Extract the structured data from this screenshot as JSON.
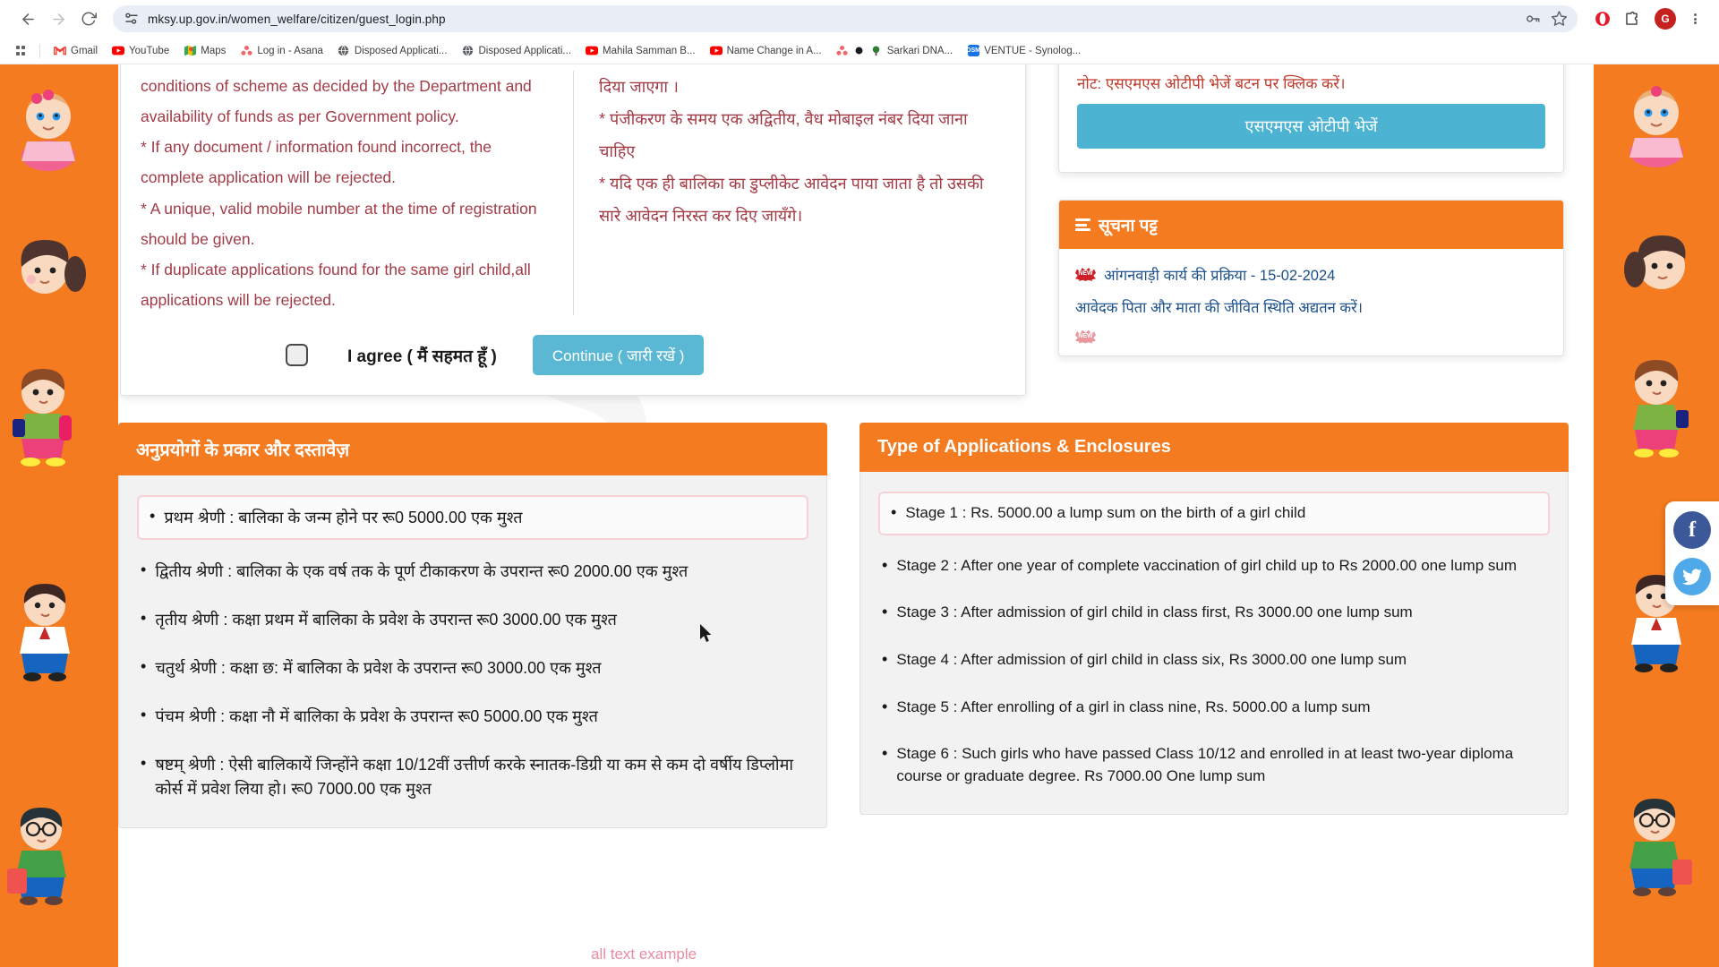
{
  "browser": {
    "url": "mksy.up.gov.in/women_welfare/citizen/guest_login.php",
    "back_icon": "back-arrow-icon",
    "forward_icon": "forward-arrow-icon",
    "reload_icon": "reload-icon",
    "site_settings_icon": "site-settings-icon",
    "password_icon": "password-key-icon",
    "bookmark_icon": "bookmark-star-icon",
    "profile_initial": "G",
    "bookmarks": [
      {
        "label": "Gmail",
        "icon": "gmail-icon",
        "color": "#ea4335"
      },
      {
        "label": "YouTube",
        "icon": "youtube-icon",
        "color": "#ff0000"
      },
      {
        "label": "Maps",
        "icon": "maps-icon",
        "color": "#34a853"
      },
      {
        "label": "Log in - Asana",
        "icon": "asana-icon",
        "color": "#f06a6a"
      },
      {
        "label": "Disposed Applicati...",
        "icon": "globe-icon",
        "color": "#5f6368"
      },
      {
        "label": "Disposed Applicati...",
        "icon": "globe-icon",
        "color": "#5f6368"
      },
      {
        "label": "Mahila Samman B...",
        "icon": "youtube-icon",
        "color": "#ff0000"
      },
      {
        "label": "Name Change in A...",
        "icon": "youtube-icon",
        "color": "#ff0000"
      },
      {
        "label": "Sarkari DNA...",
        "icon": "asana-icon",
        "color": "#f06a6a"
      },
      {
        "label": "VENTUE - Synolog...",
        "icon": "dsm-icon",
        "color": "#1a73e8"
      }
    ]
  },
  "consent": {
    "english_terms": "conditions of scheme as decided by the Department and availability of funds as per Government policy.\n* If any document / information found incorrect, the complete application will be rejected.\n* A unique, valid mobile number at the time of registration should be given.\n* If duplicate applications found for the same girl child,all applications will be rejected.",
    "hindi_terms": "दिया जाएगा ।\n* पंजीकरण के समय एक अद्वितीय, वैध मोबाइल नंबर दिया जाना चाहिए\n* यदि एक ही बालिका का डुप्लीकेट आवेदन पाया जाता है तो उसकी सारे आवेदन निरस्त कर दिए जायँगे।",
    "agree_label": "I agree ( मैं सहमत हूँ )",
    "continue_label": "Continue ( जारी रखें )",
    "checkbox_checked": false
  },
  "otp": {
    "note": "नोट: एसएमएस ओटीपी भेजें बटन पर क्लिक करें।",
    "button_label": "एसएमएस ओटीपी भेजें"
  },
  "notice_board": {
    "title": "सूचना पट्ट",
    "items": [
      {
        "badge": "NEW",
        "text": "आंगनवाड़ी कार्य की प्रक्रिया - 15-02-2024"
      },
      {
        "badge": "",
        "text": "आवेदक पिता और माता की जीवित स्थिति अद्यतन करें।"
      },
      {
        "badge": "NEW",
        "text": ""
      }
    ]
  },
  "panel_hindi": {
    "title": "अनुप्रयोगों के प्रकार और दस्तावेज़",
    "stages": [
      "प्रथम श्रेणी : बालिका के जन्म होने पर रू0 5000.00 एक मुश्त",
      "द्वितीय श्रेणी : बालिका के एक वर्ष तक के पूर्ण टीकाकरण के उपरान्त रू0 2000.00 एक मुश्त",
      "तृतीय श्रेणी : कक्षा प्रथम में बालिका के प्रवेश के उपरान्त रू0 3000.00 एक मुश्त",
      "चतुर्थ श्रेणी : कक्षा छ: में बालिका के प्रवेश के उपरान्त रू0 3000.00 एक मुश्त",
      "पंचम श्रेणी : कक्षा नौ में बालिका के प्रवेश के उपरान्त रू0 5000.00 एक मुश्त",
      "षष्टम् श्रेणी : ऐसी बालिकायें जिन्होंने कक्षा 10/12वीं उत्तीर्ण करके स्नातक-डिग्री या कम से कम दो वर्षीय डिप्लोमा कोर्स में प्रवेश लिया हो। रू0 7000.00 एक मुश्त"
    ]
  },
  "panel_english": {
    "title": "Type of Applications & Enclosures",
    "stages": [
      "Stage 1 : Rs. 5000.00 a lump sum on the birth of a girl child",
      "Stage 2 : After one year of complete vaccination of girl child up to Rs 2000.00 one lump sum",
      "Stage 3 : After admission of girl child in class first, Rs 3000.00 one lump sum",
      "Stage 4 : After admission of girl child in class six, Rs 3000.00 one lump sum",
      "Stage 5 : After enrolling of a girl in class nine, Rs. 5000.00 a lump sum",
      "Stage 6 : Such girls who have passed Class 10/12 and enrolled in at least two-year diploma course or graduate degree. Rs 7000.00 One lump sum"
    ]
  },
  "social": {
    "facebook_label": "f",
    "twitter_icon": "twitter-bird-icon"
  },
  "status_text": "all text example",
  "colors": {
    "brand_orange": "#f47b20",
    "button_blue": "#4db3d3",
    "terms_red": "#a23b46",
    "notice_blue": "#1b4f8a"
  }
}
